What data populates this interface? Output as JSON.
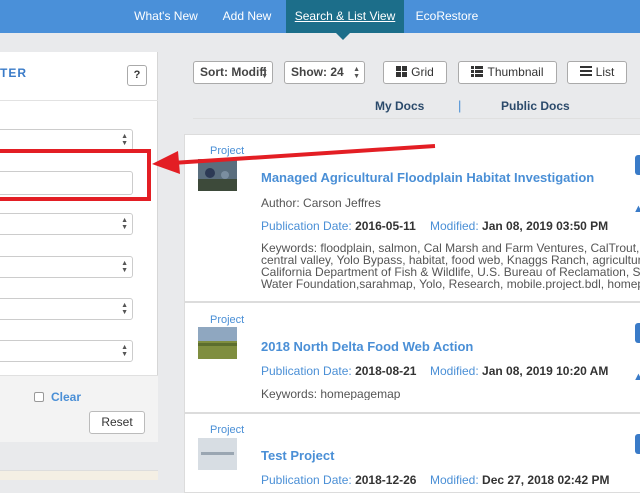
{
  "topnav": {
    "tabs": [
      {
        "label": "What's New",
        "active": false
      },
      {
        "label": "Add New",
        "active": false
      },
      {
        "label": "Search & List View",
        "active": true
      },
      {
        "label": "EcoRestore",
        "active": false
      }
    ]
  },
  "filter": {
    "title": "TER",
    "help_label": "?",
    "clear_label": "Clear",
    "reset_label": "Reset"
  },
  "toolbar": {
    "sort_label": "Sort: Modifi",
    "show_label": "Show: 24",
    "grid_label": "Grid",
    "thumbnail_label": "Thumbnail",
    "list_label": "List"
  },
  "doc_tabs": {
    "my_docs": "My Docs",
    "public_docs": "Public Docs",
    "separator": "|"
  },
  "labels": {
    "publication_date": "Publication Date:",
    "modified": "Modified:"
  },
  "results": [
    {
      "kind": "Project",
      "title": "Managed Agricultural Floodplain Habitat Investigation",
      "author": "Author: Carson Jeffres",
      "publication_date": "2016-05-11",
      "modified": "Jan 08, 2019 03:50 PM",
      "keywords": [
        "Keywords: floodplain, salmon, Cal Marsh and Farm Ventures, CalTrout, UC D",
        "central valley, Yolo Bypass, habitat, food web, Knaggs Ranch, agriculture, fi",
        "California Department of Fish & Wildlife, U.S. Bureau of Reclamation, SFCW",
        "Water Foundation,sarahmap, Yolo, Research, mobile.project.bdl, homepag"
      ]
    },
    {
      "kind": "Project",
      "title": "2018 North Delta Food Web Action",
      "author": "",
      "publication_date": "2018-08-21",
      "modified": "Jan 08, 2019 10:20 AM",
      "keywords": [
        "Keywords: homepagemap"
      ]
    },
    {
      "kind": "Project",
      "title": "Test Project",
      "author": "",
      "publication_date": "2018-12-26",
      "modified": "Dec 27, 2018 02:42 PM",
      "keywords": []
    }
  ],
  "colors": {
    "nav": "#4a90d9",
    "nav_active": "#1c6e8a",
    "accent": "#4a8fd6",
    "annotation_red": "#e31e24"
  }
}
